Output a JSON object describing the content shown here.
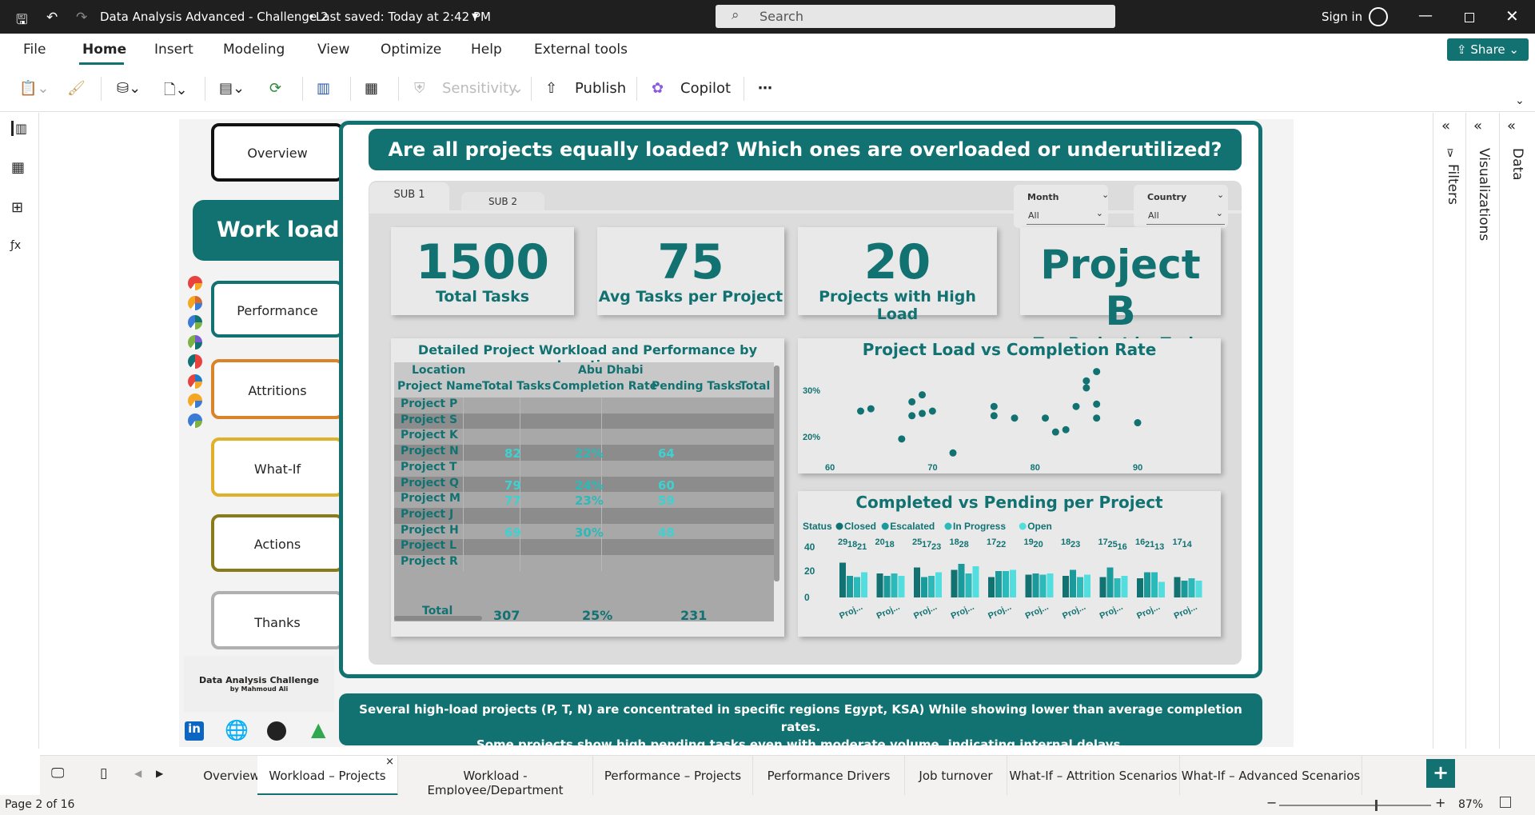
{
  "window": {
    "title": "Data Analysis Advanced - Challenge 2",
    "saved": "Last saved: Today at 2:42 PM",
    "search_placeholder": "Search",
    "signin": "Sign in"
  },
  "menu": [
    "File",
    "Home",
    "Insert",
    "Modeling",
    "View",
    "Optimize",
    "Help",
    "External tools"
  ],
  "share_label": "Share",
  "toolbar": {
    "sensitivity": "Sensitivity",
    "publish": "Publish",
    "copilot": "Copilot",
    "more": "⋯"
  },
  "right_panes": {
    "filters": "Filters",
    "visualizations": "Visualizations",
    "data": "Data"
  },
  "nav": {
    "overview": "Overview",
    "workload": "Work load",
    "performance": "Performance",
    "attritions": "Attritions",
    "whatif": "What-If",
    "actions": "Actions",
    "thanks": "Thanks"
  },
  "brand": {
    "line1": "Data Analysis Challenge",
    "line2": "by Mahmoud Ali"
  },
  "theme_colors": [
    "#e8423f",
    "#f5a623",
    "#3a7bd5",
    "#7cb342",
    "#127272"
  ],
  "question": "Are all projects equally loaded? Which ones are overloaded or underutilized?",
  "subtabs": [
    "SUB 1",
    "SUB 2"
  ],
  "slicers": [
    {
      "label": "Month",
      "value": "All"
    },
    {
      "label": "Country",
      "value": "All"
    }
  ],
  "kpis": [
    {
      "value": "1500",
      "label": "Total Tasks"
    },
    {
      "value": "75",
      "label": "Avg Tasks per Project"
    },
    {
      "value": "20",
      "label": "Projects with High Load"
    },
    {
      "value": "Project B",
      "label": "Top Project by Tasks"
    }
  ],
  "matrix": {
    "title": "Detailed Project Workload and Performance by Location",
    "header_top": [
      "Location",
      "Abu Dhabi"
    ],
    "headers": [
      "Project Name",
      "Total Tasks",
      "Completion Rate",
      "Pending Tasks",
      "Total"
    ],
    "rows": [
      [
        "Project P",
        "",
        "",
        ""
      ],
      [
        "Project S",
        "",
        "",
        ""
      ],
      [
        "Project K",
        "",
        "",
        ""
      ],
      [
        "Project N",
        "82",
        "22%",
        "64"
      ],
      [
        "Project T",
        "",
        "",
        ""
      ],
      [
        "Project Q",
        "79",
        "24%",
        "60"
      ],
      [
        "Project M",
        "77",
        "23%",
        "59"
      ],
      [
        "Project J",
        "",
        "",
        ""
      ],
      [
        "Project H",
        "69",
        "30%",
        "48"
      ],
      [
        "Project L",
        "",
        "",
        ""
      ],
      [
        "Project R",
        "",
        "",
        ""
      ]
    ],
    "total": [
      "Total",
      "307",
      "25%",
      "231"
    ]
  },
  "scatter": {
    "title": "Project Load vs Completion Rate",
    "xticks": [
      "60",
      "70",
      "80",
      "90"
    ],
    "yticks": [
      "30%",
      "20%"
    ]
  },
  "barchart": {
    "title": "Completed vs Pending per Project",
    "legend_title": "Status",
    "legend": [
      {
        "name": "Closed",
        "color": "#127272"
      },
      {
        "name": "Escalated",
        "color": "#1a9a9a"
      },
      {
        "name": "In Progress",
        "color": "#2cb9b9"
      },
      {
        "name": "Open",
        "color": "#52dede"
      }
    ],
    "yticks": [
      "40",
      "20",
      "0"
    ],
    "xlabel": "Proj..."
  },
  "chart_data": [
    {
      "type": "scatter",
      "title": "Project Load vs Completion Rate",
      "xlim": [
        60,
        90
      ],
      "ylim": [
        0.15,
        0.36
      ],
      "points": [
        [
          63,
          0.255
        ],
        [
          64,
          0.26
        ],
        [
          67,
          0.195
        ],
        [
          68,
          0.275
        ],
        [
          68,
          0.245
        ],
        [
          69,
          0.29
        ],
        [
          69,
          0.25
        ],
        [
          70,
          0.255
        ],
        [
          72,
          0.165
        ],
        [
          76,
          0.265
        ],
        [
          76,
          0.245
        ],
        [
          78,
          0.24
        ],
        [
          81,
          0.24
        ],
        [
          82,
          0.21
        ],
        [
          83,
          0.215
        ],
        [
          84,
          0.265
        ],
        [
          85,
          0.305
        ],
        [
          85,
          0.32
        ],
        [
          86,
          0.34
        ],
        [
          86,
          0.27
        ],
        [
          86,
          0.24
        ],
        [
          90,
          0.23
        ]
      ]
    },
    {
      "type": "bar",
      "title": "Completed vs Pending per Project",
      "categories": [
        "Proj...",
        "Proj...",
        "Proj...",
        "Proj...",
        "Proj...",
        "Proj...",
        "Proj...",
        "Proj...",
        "Proj...",
        "Proj..."
      ],
      "ylim": [
        0,
        40
      ],
      "series": [
        {
          "name": "Closed",
          "values": [
            29,
            20,
            25,
            23,
            17,
            19,
            18,
            17,
            16,
            17
          ]
        },
        {
          "name": "Escalated",
          "values": [
            18,
            18,
            17,
            28,
            22,
            20,
            23,
            25,
            21,
            14
          ]
        },
        {
          "name": "In Progress",
          "values": [
            17,
            20,
            18,
            20,
            22,
            19,
            17,
            16,
            21,
            16
          ]
        },
        {
          "name": "Open",
          "values": [
            21,
            18,
            21,
            26,
            23,
            20,
            19,
            18,
            13,
            14
          ]
        }
      ],
      "data_labels": [
        [
          "29",
          "18",
          "21"
        ],
        [
          "20",
          "18"
        ],
        [
          "25",
          "17",
          "23"
        ],
        [
          "18",
          "28"
        ],
        [
          "17",
          "22"
        ],
        [
          "19",
          "20"
        ],
        [
          "18",
          "23"
        ],
        [
          "17",
          "25",
          "16"
        ],
        [
          "16",
          "21",
          "13"
        ],
        [
          "17",
          "14"
        ]
      ]
    }
  ],
  "insight": "Several high-load projects (P, T, N) are concentrated in specific regions Egypt, KSA) While showing lower than average completion rates.\nSome projects show high pending tasks even with moderate volume, indicating internal delays.",
  "pages": [
    "Overview",
    "Workload – Projects",
    "Workload - Employee/Department",
    "Performance – Projects",
    "Performance Drivers",
    "Job turnover",
    "What-If – Attrition Scenarios",
    "What-If – Advanced Scenarios"
  ],
  "status": {
    "page": "Page 2 of 16",
    "zoom": "87%"
  }
}
